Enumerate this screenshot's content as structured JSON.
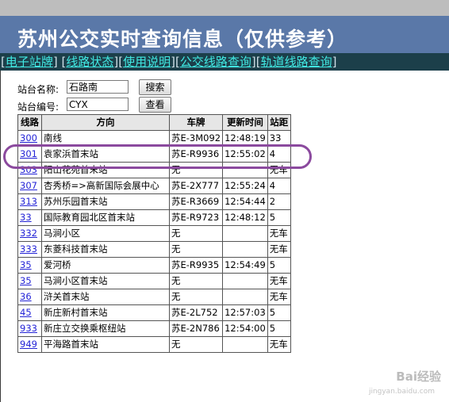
{
  "header": {
    "title": "苏州公交实时查询信息（仅供参考）"
  },
  "nav": [
    {
      "label": "电子站牌"
    },
    {
      "label": "线路状态"
    },
    {
      "label": "使用说明"
    },
    {
      "label": "公交线路查询"
    },
    {
      "label": "轨道线路查询"
    }
  ],
  "form": {
    "station_name_label": "站台名称:",
    "station_name_value": "石路南",
    "search_button": "搜索",
    "station_code_label": "站台编号:",
    "station_code_value": "CYX",
    "view_button": "查看"
  },
  "table": {
    "headers": [
      "线路",
      "方向",
      "车牌",
      "更新时间",
      "站距"
    ],
    "rows": [
      [
        "300",
        "南线",
        "苏E-3M092",
        "12:48:19",
        "33"
      ],
      [
        "301",
        "袁家浜首末站",
        "苏E-R9936",
        "12:55:02",
        "4"
      ],
      [
        "303",
        "阳山花苑首末站",
        "无",
        "",
        "无车"
      ],
      [
        "307",
        "杏秀桥=>高新国际会展中心",
        "苏E-2X777",
        "12:55:24",
        "4"
      ],
      [
        "313",
        "苏州乐园首末站",
        "苏E-R3669",
        "12:54:44",
        "2"
      ],
      [
        "33",
        "国际教育园北区首末站",
        "苏E-R9723",
        "12:48:12",
        "5"
      ],
      [
        "332",
        "马涧小区",
        "无",
        "",
        "无车"
      ],
      [
        "333",
        "东菱科技首末站",
        "无",
        "",
        "无车"
      ],
      [
        "35",
        "爱河桥",
        "苏E-R9935",
        "12:54:49",
        "5"
      ],
      [
        "35",
        "马涧小区首末站",
        "无",
        "",
        "无车"
      ],
      [
        "36",
        "浒关首末站",
        "无",
        "",
        "无车"
      ],
      [
        "45",
        "新庄新村首末站",
        "苏E-2L752",
        "12:57:03",
        "5"
      ],
      [
        "933",
        "新庄立交换乘枢纽站",
        "苏E-2N786",
        "12:54:00",
        "5"
      ],
      [
        "949",
        "平海路首末站",
        "无",
        "",
        "无车"
      ]
    ]
  },
  "watermark": {
    "text": "Bai经验",
    "sub": "jingyan.baidu.com"
  },
  "colors": {
    "title_bar": "#5a78a8",
    "nav_bar": "#1c3f4a",
    "nav_link": "#41e9e3",
    "line_link": "#2323d6",
    "highlight": "#8b4a9e"
  }
}
